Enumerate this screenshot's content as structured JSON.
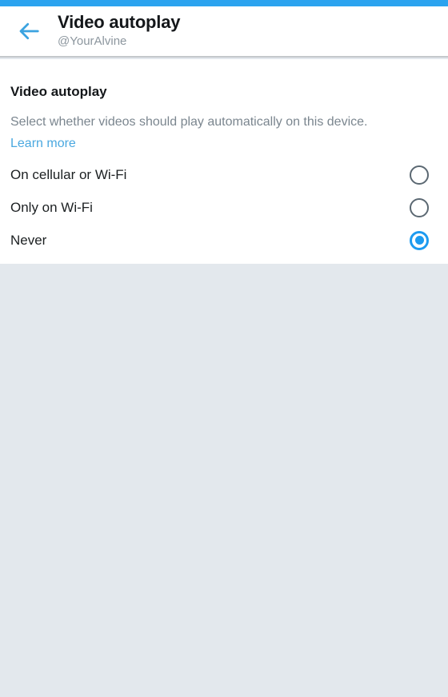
{
  "theme": {
    "status_bar_color": "#2ba3ef",
    "accent_color": "#1d9bf0",
    "link_color": "#4aa8e0",
    "background_color": "#e3e8ed",
    "card_color": "#ffffff",
    "title_color": "#14171a",
    "muted_text_color": "#7b868f"
  },
  "header": {
    "back_icon": "arrow-left-icon",
    "title": "Video autoplay",
    "subtitle": "@YourAlvine"
  },
  "content": {
    "section_title": "Video autoplay",
    "description": "Select whether videos should play automatically on this device.",
    "learn_more_label": "Learn more",
    "options": [
      {
        "label": "On cellular or Wi-Fi",
        "selected": false
      },
      {
        "label": "Only on Wi-Fi",
        "selected": false
      },
      {
        "label": "Never",
        "selected": true
      }
    ]
  }
}
